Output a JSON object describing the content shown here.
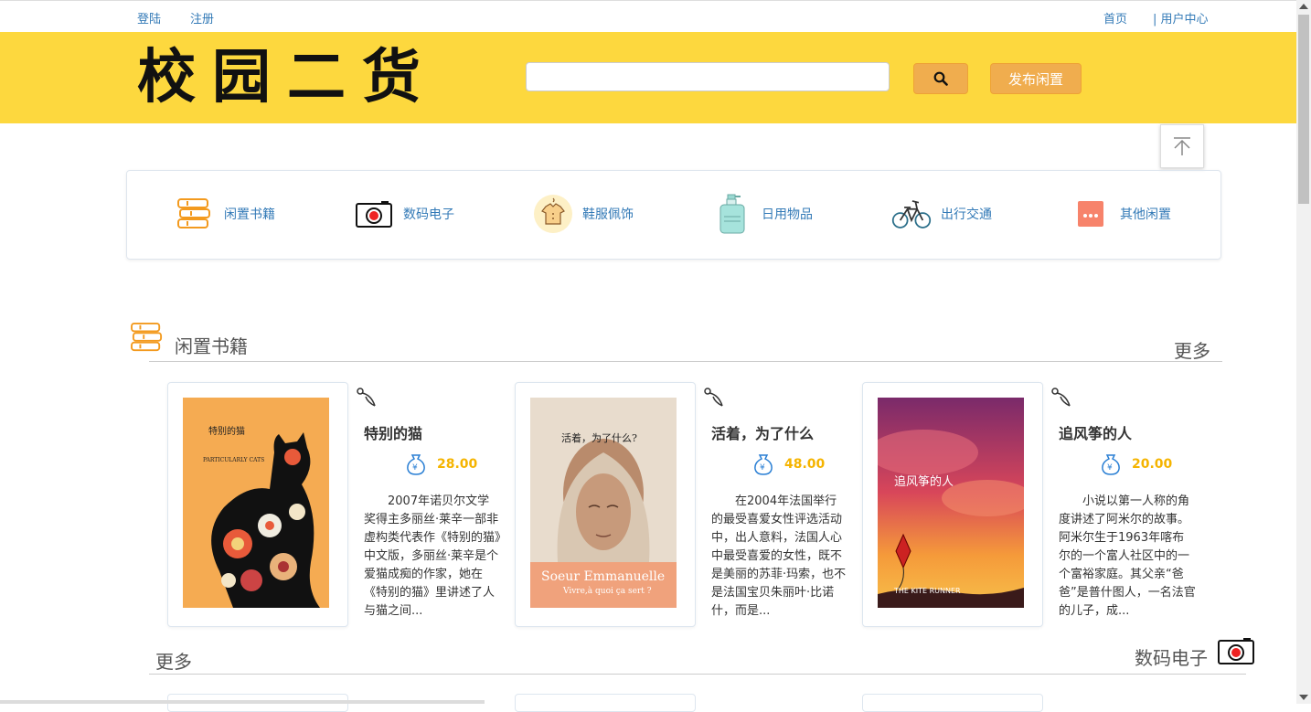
{
  "topbar": {
    "login": "登陆",
    "register": "注册",
    "home": "首页",
    "user_center": "| 用户中心"
  },
  "header": {
    "logo": "校园二货",
    "search_placeholder": "",
    "search_icon": "search-icon",
    "publish_label": "发布闲置",
    "accent_color": "#fdd83e",
    "button_color": "#f0ad4e"
  },
  "categories": [
    {
      "label": "闲置书籍",
      "icon": "books-icon"
    },
    {
      "label": "数码电子",
      "icon": "camera-icon"
    },
    {
      "label": "鞋服佩饰",
      "icon": "shirt-icon"
    },
    {
      "label": "日用物品",
      "icon": "bottle-icon"
    },
    {
      "label": "出行交通",
      "icon": "bicycle-icon"
    },
    {
      "label": "其他闲置",
      "icon": "more-icon"
    }
  ],
  "sections": {
    "books": {
      "title": "闲置书籍",
      "more": "更多"
    },
    "digital": {
      "title": "数码电子",
      "more": "更多"
    }
  },
  "books": [
    {
      "title": "特别的猫",
      "price": "28.00",
      "cover_title": "特别的猫",
      "cover_sub": "PARTICULARLY CATS",
      "description": "2007年诺贝尔文学奖得主多丽丝·莱辛一部非虚构类代表作《特别的猫》中文版，多丽丝·莱辛是个爱猫成痴的作家，她在《特别的猫》里讲述了人与猫之间..."
    },
    {
      "title": "活着，为了什么",
      "price": "48.00",
      "cover_title": "活着，为了什么?",
      "cover_sub": "Soeur Emmanuelle",
      "cover_sub2": "Vivre,à quoi ça sert ?",
      "description": "在2004年法国举行的最受喜爱女性评选活动中，出人意料，法国人心中最受喜爱的女性，既不是美丽的苏菲·玛索，也不是法国宝贝朱丽叶·比诺什，而是..."
    },
    {
      "title": "追风筝的人",
      "price": "20.00",
      "cover_title": "追风筝的人",
      "cover_sub": "THE KITE RUNNER",
      "description": "小说以第一人称的角度讲述了阿米尔的故事。阿米尔生于1963年喀布尔的一个富人社区中的一个富裕家庭。其父亲“爸爸”是普什图人，一名法官的儿子，成..."
    }
  ]
}
